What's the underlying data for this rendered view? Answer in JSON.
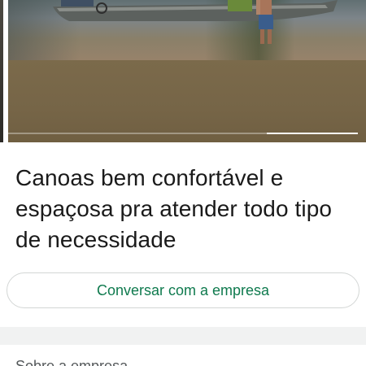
{
  "carousel": {
    "slide_count": 2,
    "active_slide": 2
  },
  "description": {
    "text": "Canoas bem confortável e espaçosa pra atender todo tipo de necessidade"
  },
  "cta": {
    "label": "Conversar com a empresa",
    "color": "#0f7a4e"
  },
  "about": {
    "heading": "Sobre a empresa"
  },
  "colors": {
    "accent": "#0f7a4e",
    "text": "#1a1a1a",
    "divider": "#f1f2f2"
  }
}
